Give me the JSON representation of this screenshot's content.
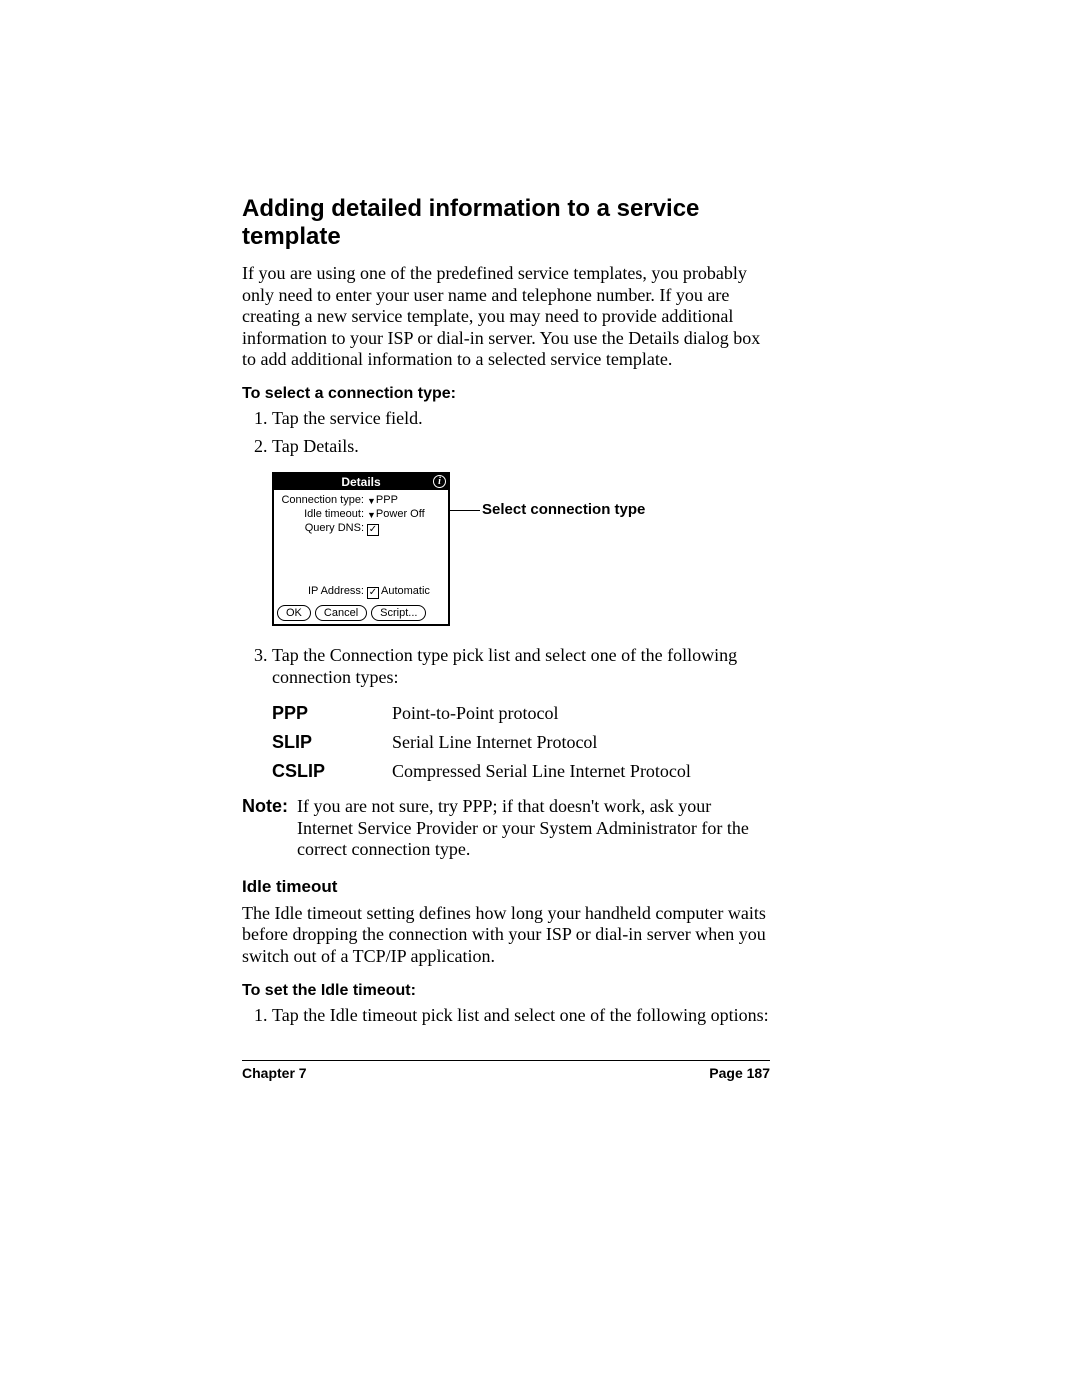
{
  "heading": "Adding detailed information to a service template",
  "intro": "If you are using one of the predefined service templates, you probably only need to enter your user name and telephone number. If you are creating a new service template, you may need to provide additional information to your ISP or dial-in server. You use the Details dialog box to add additional information to a selected service template.",
  "proc1": {
    "title": "To select a connection type:",
    "steps": [
      "Tap the service field.",
      "Tap Details."
    ]
  },
  "palm": {
    "title": "Details",
    "fields": {
      "conn_label": "Connection type:",
      "conn_val": "PPP",
      "idle_label": "Idle timeout:",
      "idle_val": "Power Off",
      "dns_label": "Query DNS:",
      "ip_label": "IP Address:",
      "ip_val": "Automatic"
    },
    "buttons": {
      "ok": "OK",
      "cancel": "Cancel",
      "script": "Script..."
    }
  },
  "callout": "Select connection type",
  "step3": "Tap the Connection type pick list and select one of the following connection types:",
  "defs": [
    {
      "term": "PPP",
      "desc": "Point-to-Point protocol"
    },
    {
      "term": "SLIP",
      "desc": "Serial Line Internet Protocol"
    },
    {
      "term": "CSLIP",
      "desc": "Compressed Serial Line Internet Protocol"
    }
  ],
  "note": {
    "label": "Note:",
    "text": "If you are not sure, try PPP; if that doesn't work, ask your Internet Service Provider or your System Administrator for the correct connection type."
  },
  "sub": {
    "title": "Idle timeout",
    "body": "The Idle timeout setting defines how long your handheld computer waits before dropping the connection with your ISP or dial-in server when you switch out of a TCP/IP application."
  },
  "proc2": {
    "title": "To set the Idle timeout:",
    "step1": "Tap the Idle timeout pick list and select one of the following options:"
  },
  "footer": {
    "left": "Chapter 7",
    "right": "Page 187"
  }
}
